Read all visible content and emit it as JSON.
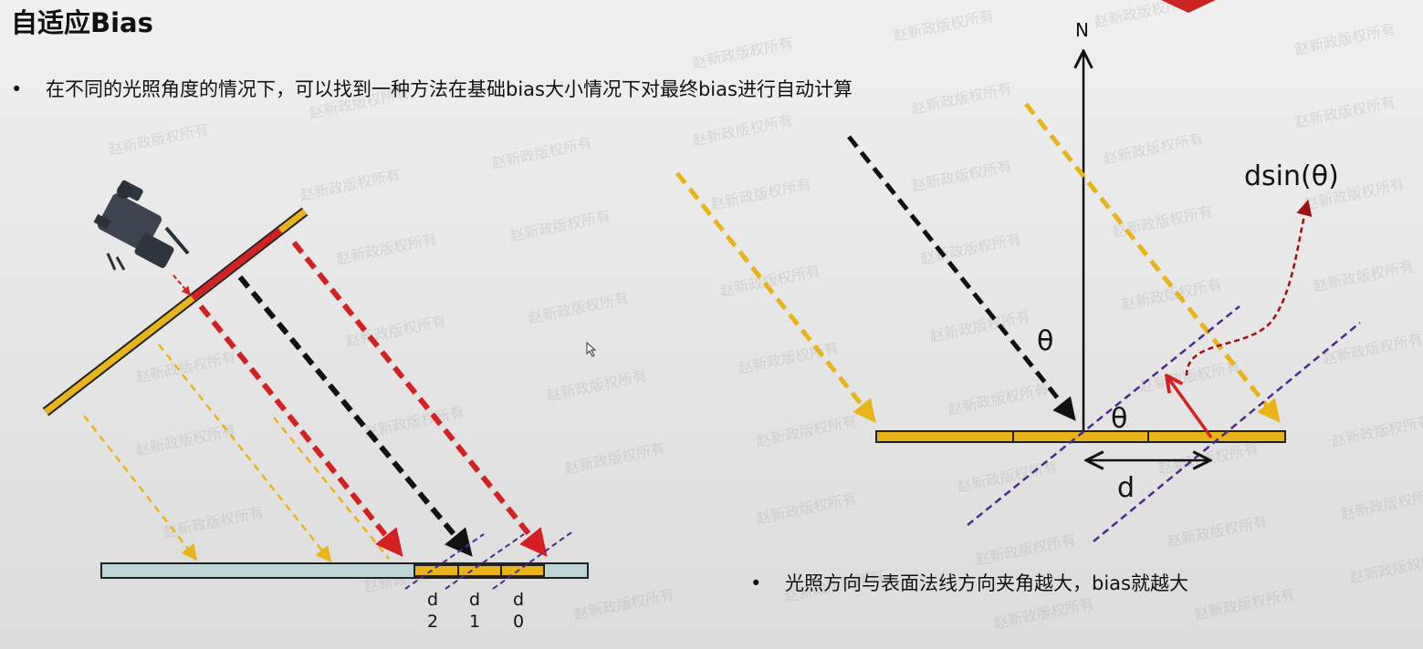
{
  "title": "自适应Bias",
  "bullets": [
    "在不同的光照角度的情况下，可以找到一种方法在基础bias大小情况下对最终bias进行自动计算",
    "光照方向与表面法线方向夹角越大，bias就越大"
  ],
  "left_diagram": {
    "sample_labels": [
      {
        "letter": "d",
        "digit": "2"
      },
      {
        "letter": "d",
        "digit": "1"
      },
      {
        "letter": "d",
        "digit": "0"
      }
    ]
  },
  "right_diagram": {
    "normal_label": "N",
    "theta_incident_label": "θ",
    "theta_bias_label": "θ",
    "distance_label": "d",
    "offset_label": "dsin(θ)"
  },
  "watermark_text": "赵新政版权所有",
  "colors": {
    "yellow": "#e8b418",
    "red": "#d42020",
    "dark_red": "#a01010",
    "black": "#111111",
    "purple": "#4a2a8a",
    "ground": "#bcd6d8",
    "red_corner": "#cc2222"
  }
}
